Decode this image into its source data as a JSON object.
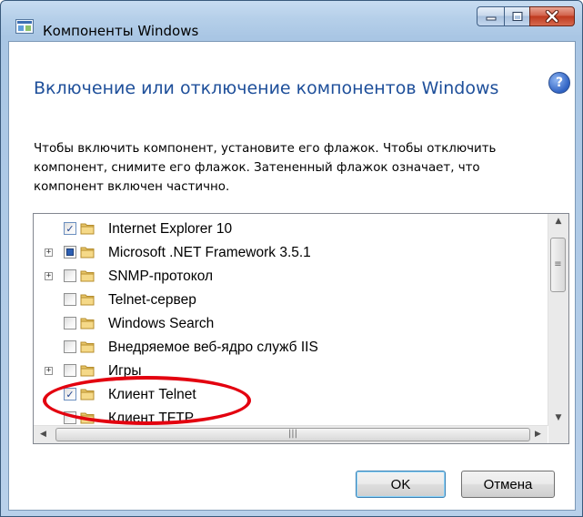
{
  "window": {
    "title": "Компоненты Windows"
  },
  "dialog": {
    "heading": "Включение или отключение компонентов Windows",
    "description": "Чтобы включить компонент, установите его флажок. Чтобы отключить компонент, снимите его флажок. Затененный флажок означает, что компонент включен частично."
  },
  "features": [
    {
      "label": "Internet Explorer 10",
      "state": "checked",
      "expandable": false
    },
    {
      "label": "Microsoft .NET Framework 3.5.1",
      "state": "partial",
      "expandable": true
    },
    {
      "label": "SNMP-протокол",
      "state": "unchecked",
      "expandable": true
    },
    {
      "label": "Telnet-сервер",
      "state": "unchecked",
      "expandable": false
    },
    {
      "label": "Windows Search",
      "state": "unchecked",
      "expandable": false
    },
    {
      "label": "Внедряемое веб-ядро служб IIS",
      "state": "unchecked",
      "expandable": false
    },
    {
      "label": "Игры",
      "state": "unchecked",
      "expandable": true
    },
    {
      "label": "Клиент Telnet",
      "state": "checked",
      "expandable": false
    },
    {
      "label": "Клиент TFTP",
      "state": "unchecked",
      "expandable": false
    }
  ],
  "buttons": {
    "ok": "OK",
    "cancel": "Отмена"
  },
  "colors": {
    "heading": "#1e4f9a",
    "annotation": "#e3000f"
  },
  "icons": {
    "help": "?"
  }
}
